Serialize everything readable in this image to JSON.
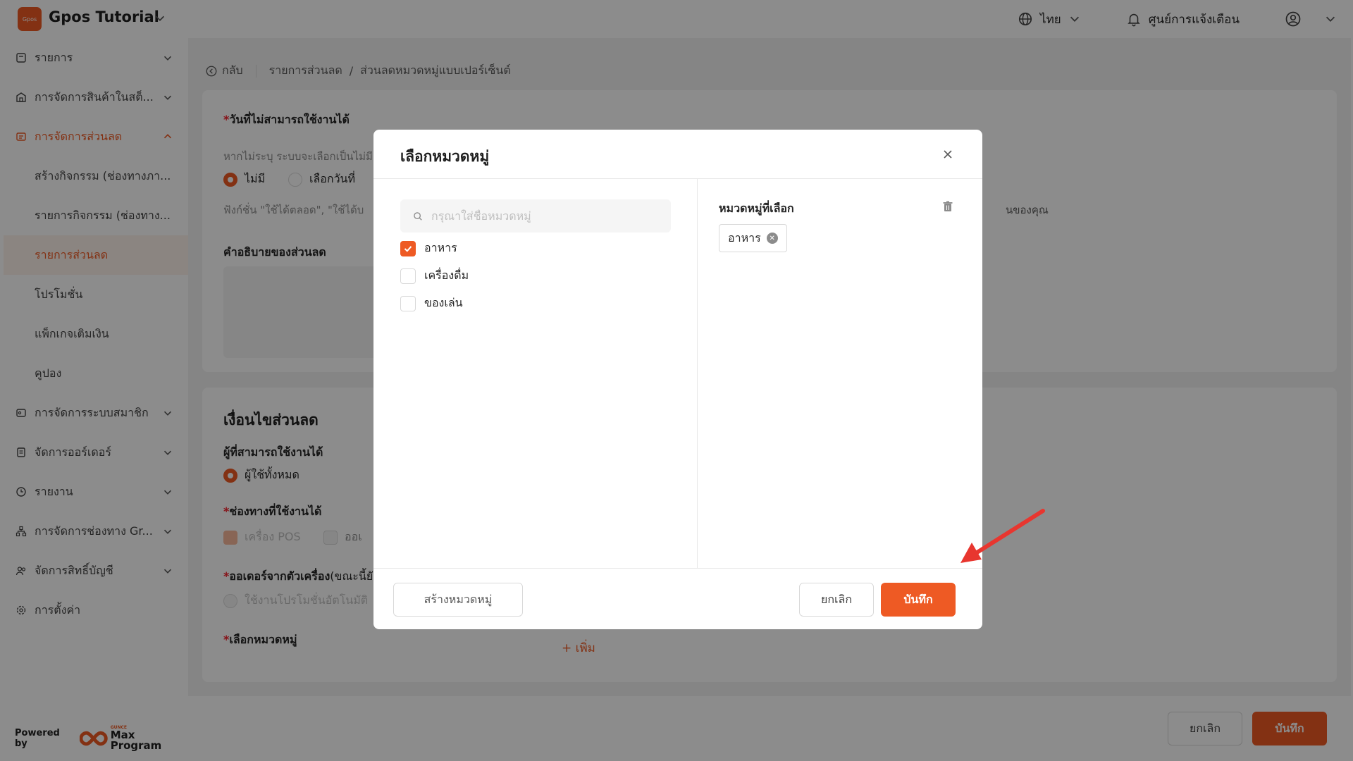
{
  "topbar": {
    "logo_text": "Gpos",
    "app_title": "Gpos Tutorial",
    "language": "ไทย",
    "notifications": "ศูนย์การแจ้งเตือน"
  },
  "sidebar": {
    "items": [
      {
        "label": "รายการ"
      },
      {
        "label": "การจัดการสินค้าในสต็..."
      },
      {
        "label": "การจัดการส่วนลด"
      },
      {
        "label": "การจัดการระบบสมาชิก"
      },
      {
        "label": "จัดการออร์เดอร์"
      },
      {
        "label": "รายงาน"
      },
      {
        "label": "การจัดการช่องทาง Gr..."
      },
      {
        "label": "จัดการสิทธิ์บัญชี"
      },
      {
        "label": "การตั้งค่า"
      }
    ],
    "subitems": [
      {
        "label": "สร้างกิจกรรม (ช่องทางภา..."
      },
      {
        "label": "รายการกิจกรรม (ช่องทาง..."
      },
      {
        "label": "รายการส่วนลด"
      },
      {
        "label": "โปรโมชั่น"
      },
      {
        "label": "แพ็กเกจเติมเงิน"
      },
      {
        "label": "คูปอง"
      }
    ],
    "powered_by": "Powered by",
    "brand_small": "GUNCE",
    "brand": "Max Program"
  },
  "breadcrumb": {
    "back": "กลับ",
    "level1": "รายการส่วนลด",
    "divider": "/",
    "level2": "ส่วนลดหมวดหมู่แบบเปอร์เซ็นต์"
  },
  "form": {
    "unusable_dates_label": "วันที่ไม่สามารถใช้งานได้",
    "unusable_dates_hint": "หากไม่ระบุ ระบบจะเลือกเป็นไม่มี",
    "radio_none": "ไม่มี",
    "radio_pick": "เลือกวันที่",
    "function_hint": "ฟังก์ชั่น \"ใช้ได้ตลอด\", \"ใช้ได้บ",
    "function_hint_tail": "นของคุณ",
    "description_label": "คำอธิบายของส่วนลด",
    "conditions_title": "เงื่อนไขส่วนลด",
    "users_label": "ผู้ที่สามารถใช้งานได้",
    "users_all": "ผู้ใช้ทั้งหมด",
    "channels_label": "ช่องทางที่ใช้งานได้",
    "channel_pos": "เครื่อง POS",
    "channel_online": "ออเ",
    "order_label": "ออเดอร์จากตัวเครื่อง",
    "order_label_suffix": "(ขณะนี้ยัง",
    "auto_promo": "ใช้งานโปรโมชั่นอัตโนมัติ",
    "select_category_label": "เลือกหมวดหมู่",
    "add_link": "+ เพิ่ม",
    "required_mark": "*"
  },
  "bottombar": {
    "cancel": "ยกเลิก",
    "save": "บันทึก"
  },
  "modal": {
    "title": "เลือกหมวดหมู่",
    "search_placeholder": "กรุณาใส่ชื่อหมวดหมู่",
    "categories": [
      {
        "label": "อาหาร",
        "checked": true
      },
      {
        "label": "เครื่องดื่ม",
        "checked": false
      },
      {
        "label": "ของเล่น",
        "checked": false
      }
    ],
    "selected_title": "หมวดหมู่ที่เลือก",
    "selected_tags": [
      {
        "label": "อาหาร"
      }
    ],
    "create_button": "สร้างหมวดหมู่",
    "cancel_button": "ยกเลิก",
    "save_button": "บันทึก"
  },
  "colors": {
    "accent": "#ee5a24",
    "annotation_arrow": "#e8362f"
  }
}
